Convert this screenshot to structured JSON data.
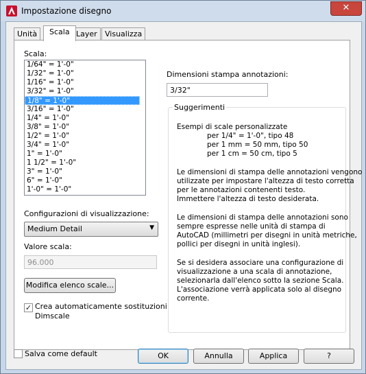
{
  "window": {
    "title": "Impostazione disegno",
    "close_label": "✕"
  },
  "tabs": [
    {
      "label": "Unità"
    },
    {
      "label": "Scala"
    },
    {
      "label": "Layer"
    },
    {
      "label": "Visualizza"
    }
  ],
  "scale": {
    "label": "Scala:",
    "items": [
      "1/64\" = 1'-0\"",
      "1/32\" = 1'-0\"",
      "1/16\" = 1'-0\"",
      "3/32\" = 1'-0\"",
      "1/8\" = 1'-0\"",
      "3/16\" = 1'-0\"",
      "1/4\" = 1'-0\"",
      "3/8\" = 1'-0\"",
      "1/2\" = 1'-0\"",
      "3/4\" = 1'-0\"",
      "1\" = 1'-0\"",
      "1 1/2\" = 1'-0\"",
      "3\" = 1'-0\"",
      "6\" = 1'-0\"",
      "1'-0\" = 1'-0\""
    ],
    "selected_index": 4
  },
  "config": {
    "label": "Configurazioni di visualizzazione:",
    "value": "Medium Detail"
  },
  "scale_value": {
    "label": "Valore scala:",
    "value": "96.000"
  },
  "modify_button": "Modifica elenco scale...",
  "auto_create": {
    "line1": "Crea automaticamente sostituzioni",
    "line2": "Dimscale",
    "checked": true
  },
  "annotation_size": {
    "label": "Dimensioni stampa annotazioni:",
    "value": "3/32\""
  },
  "hints": {
    "title": "Suggerimenti",
    "lines": [
      "Esempi di scale personalizzate",
      "per 1/4\" = 1'-0\", tipo 48",
      "per 1 mm = 50 mm, tipo 50",
      "per 1 cm = 50 cm, tipo 5",
      "Le dimensioni di stampa delle annotazioni vengono",
      "utilizzate per impostare l'altezza di testo corretta",
      "per le annotazioni contenenti testo.",
      "Immettere l'altezza di testo desiderata.",
      "Le dimensioni di stampa delle annotazioni sono",
      "sempre espresse nelle unità di stampa di",
      "AutoCAD (millimetri per disegni in unità metriche,",
      "pollici per disegni in unità inglesi).",
      "Se si desidera associare una configurazione di",
      "visualizzazione a una scala di annotazione,",
      "selezionarla dall'elenco sotto la sezione Scala.",
      "L'associazione verrà applicata solo al disegno",
      "corrente."
    ]
  },
  "footer": {
    "save_default": "Salva come default",
    "save_default_checked": false,
    "ok": "OK",
    "cancel": "Annulla",
    "apply": "Applica",
    "help": "?"
  }
}
